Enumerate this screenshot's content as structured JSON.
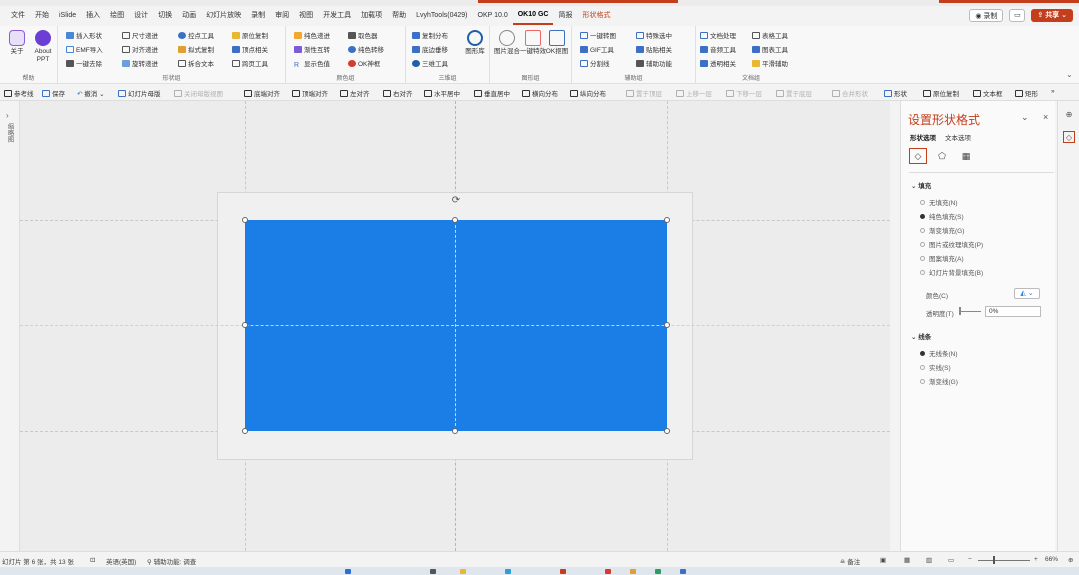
{
  "menu": {
    "tabs": [
      "文件",
      "开始",
      "iSlide",
      "插入",
      "绘图",
      "设计",
      "切换",
      "动画",
      "幻灯片放映",
      "录制",
      "审阅",
      "视图",
      "开发工具",
      "加载项",
      "帮助",
      "LvyhTools(0429)",
      "OKP 10.0",
      "OK10 GC",
      "简报",
      "形状格式"
    ],
    "record_label": "录制",
    "share_label": "共享"
  },
  "ribbon": {
    "help_group": {
      "label": "帮助",
      "about": "关于",
      "about_ppt": "About PPT"
    },
    "shape_group": {
      "label": "形状组",
      "items": [
        "插入形状",
        "EMF导入",
        "一键去除",
        "尺寸递进",
        "对齐递进",
        "旋转递进",
        "控点工具",
        "拟式复制",
        "拆合文本",
        "原位复制",
        "顶点相关",
        "跨页工具"
      ]
    },
    "color_group": {
      "label": "颜色组",
      "items": [
        "纯色递进",
        "渐性互转",
        "显示色值",
        "取色器",
        "纯色转移",
        "OK神框"
      ]
    },
    "three_d_group": {
      "label": "三维组",
      "items": [
        "复制分布",
        "底边垂移",
        "三维工具"
      ],
      "big_label": "图形库"
    },
    "image_group": {
      "label": "图形组",
      "items": [
        "图片混合",
        "一键特效",
        "OK抠图"
      ]
    },
    "aux_group": {
      "label": "辅助组",
      "items": [
        "一键转图",
        "GIF工具",
        "分割线",
        "特殊选中",
        "贴贴相关",
        "辅助功能"
      ]
    },
    "doc_group": {
      "label": "文档组",
      "items": [
        "文档处理",
        "音频工具",
        "透明相关",
        "表格工具",
        "图表工具",
        "平滑辅助"
      ]
    }
  },
  "qat": {
    "items": [
      "参考线",
      "保存",
      "撤消",
      "幻灯片母版",
      "关闭母版视图",
      "底端对齐",
      "顶端对齐",
      "左对齐",
      "右对齐",
      "水平居中",
      "垂直居中",
      "横向分布",
      "纵向分布",
      "置于顶层",
      "上移一层",
      "下移一层",
      "置于底层",
      "合并形状",
      "形状",
      "原位复制",
      "文本框",
      "矩形"
    ]
  },
  "leftbar": {
    "label": "缩略图"
  },
  "pane": {
    "title": "设置形状格式",
    "tabs": [
      "形状选项",
      "文本选项"
    ],
    "fill": {
      "heading": "填充",
      "options": [
        "无填充(N)",
        "纯色填充(S)",
        "渐变填充(G)",
        "图片或纹理填充(P)",
        "图案填充(A)",
        "幻灯片背景填充(B)"
      ],
      "selected": "纯色填充(S)",
      "color_label": "颜色(C)",
      "transparency_label": "透明度(T)",
      "transparency_value": "0%"
    },
    "line": {
      "heading": "线条",
      "options": [
        "无线条(N)",
        "实线(S)",
        "渐变线(G)"
      ],
      "selected": "无线条(N)"
    }
  },
  "shape": {
    "fill_color": "#1a7ee6"
  },
  "status": {
    "slide_info": "幻灯片 第 6 张，共 13 张",
    "language": "英语(英国)",
    "accessibility": "辅助功能: 调查",
    "notes": "备注",
    "zoom": "66%"
  }
}
